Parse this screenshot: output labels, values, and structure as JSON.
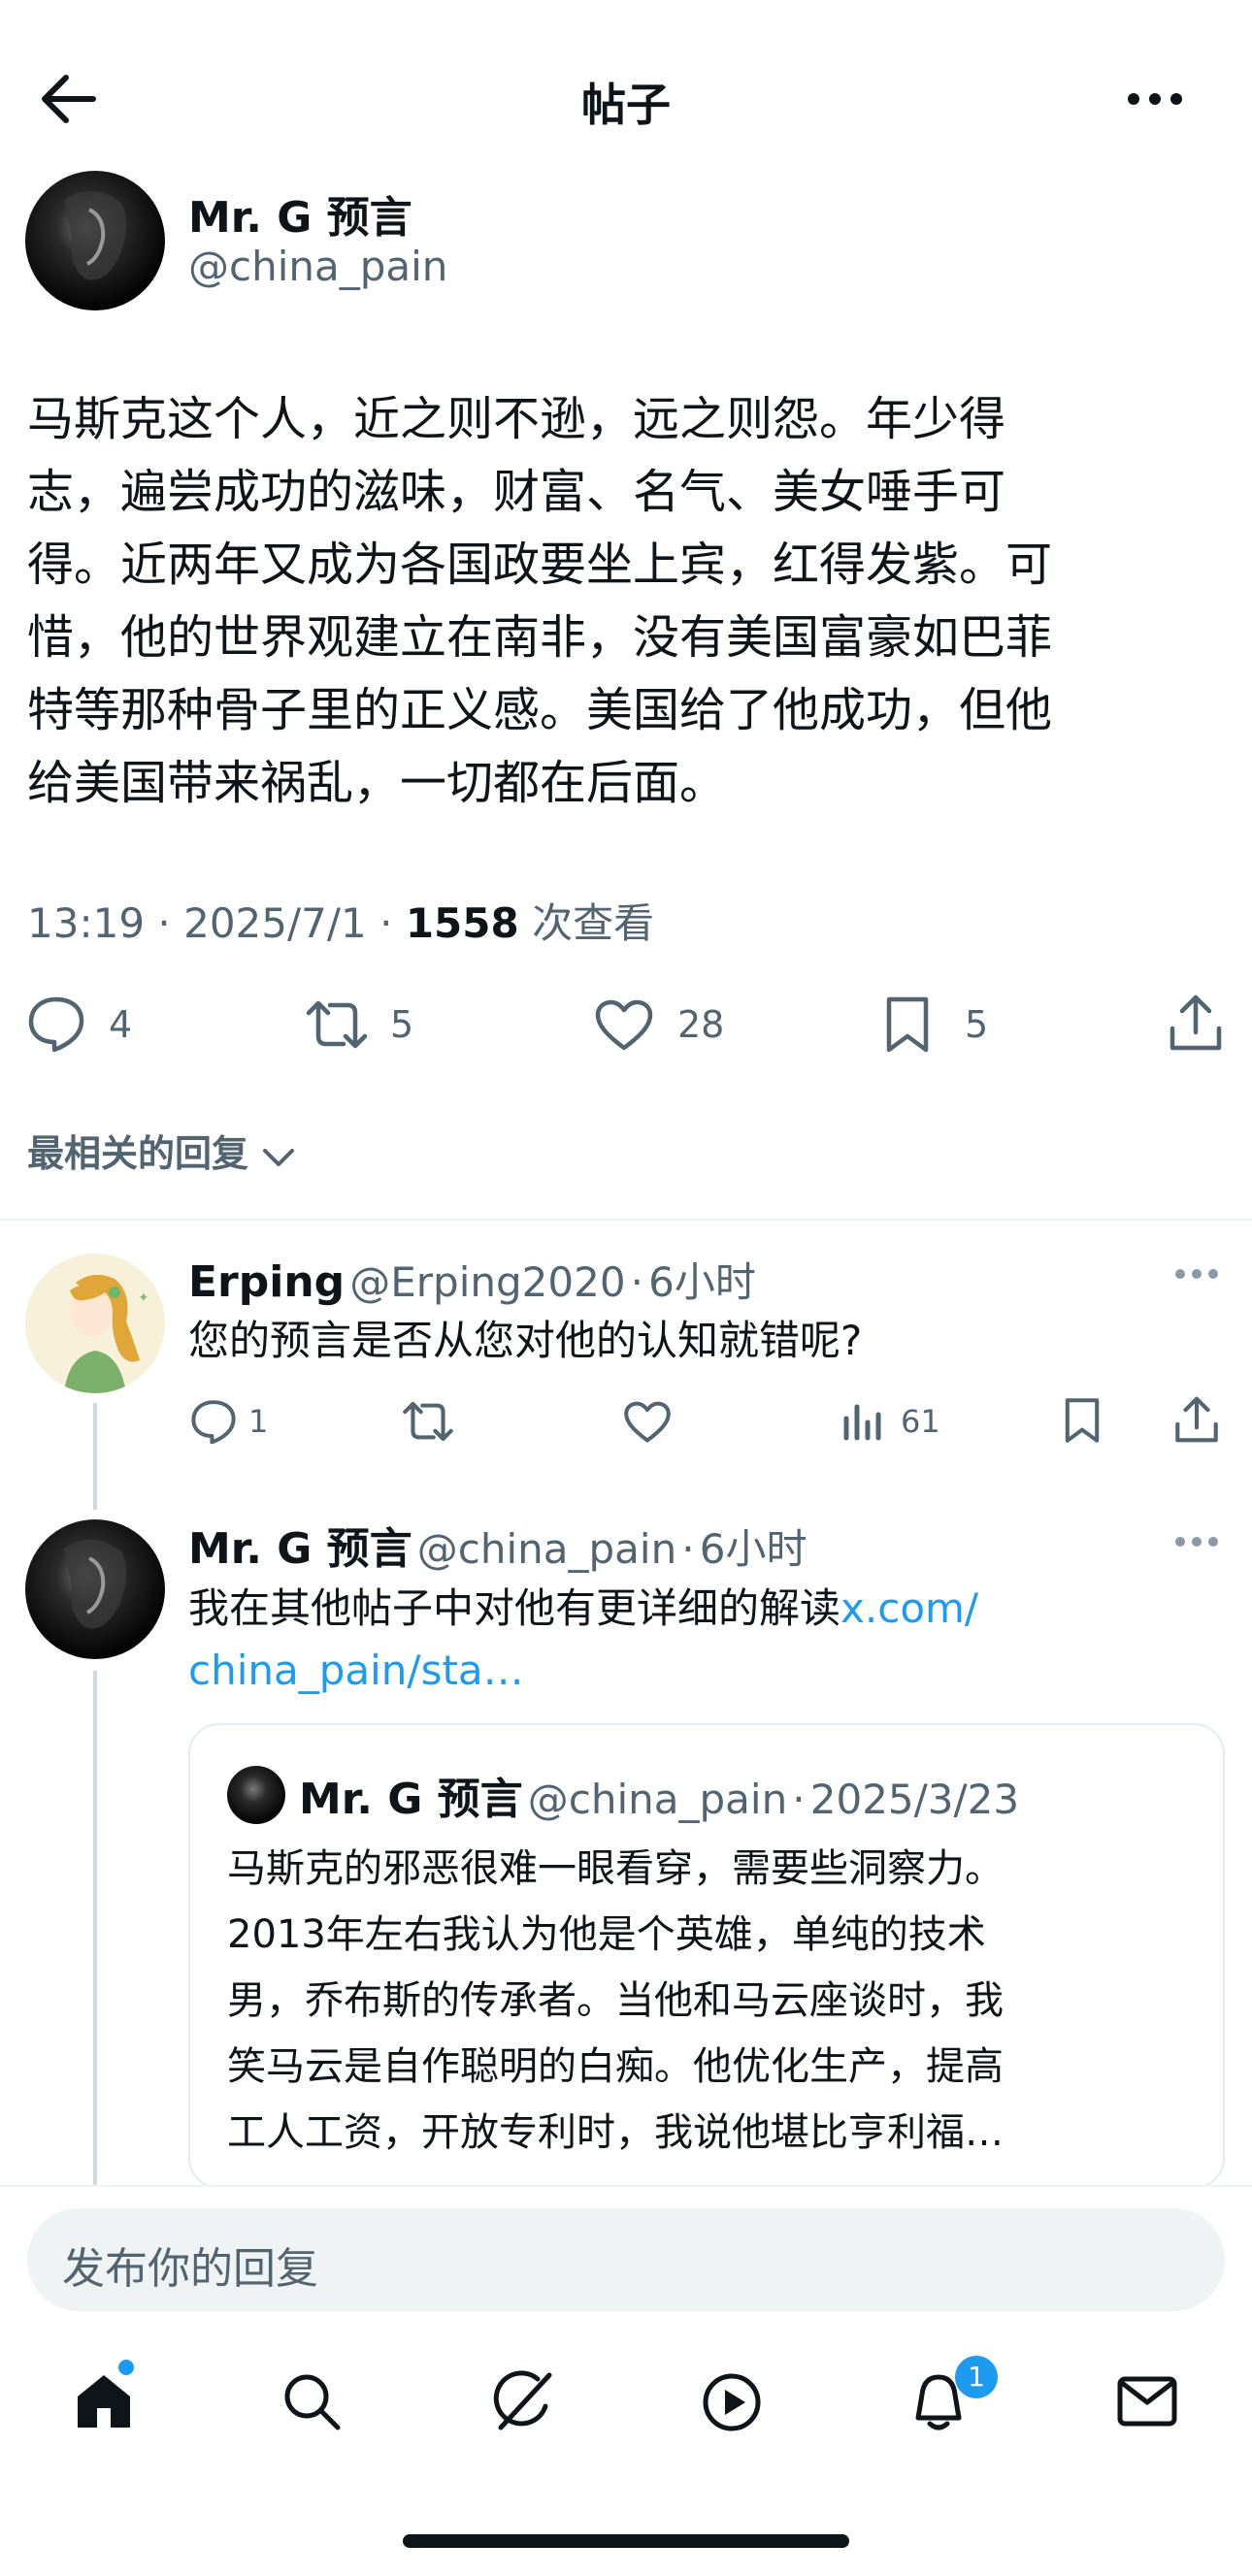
{
  "header": {
    "title": "帖子"
  },
  "post": {
    "author_name": "Mr. G 预言",
    "author_handle": "@china_pain",
    "body_lines": [
      "马斯克这个人，近之则不逊，远之则怨。年少得",
      "志，遍尝成功的滋味，财富、名气、美女唾手可",
      "得。近两年又成为各国政要坐上宾，红得发紫。可",
      "惜，他的世界观建立在南非，没有美国富豪如巴菲",
      "特等那种骨子里的正义感。美国给了他成功，但他",
      "给美国带来祸乱，一切都在后面。"
    ],
    "time": "13:19",
    "date": "2025/7/1",
    "views": "1558",
    "views_label": "次查看",
    "replies": "4",
    "reposts": "5",
    "likes": "28",
    "bookmarks": "5"
  },
  "sort_label": "最相关的回复",
  "replies": [
    {
      "name": "Erping",
      "handle": "@Erping2020",
      "age": "6小时",
      "text": "您的预言是否从您对他的认知就错呢?",
      "reply_count": "1",
      "views": "61"
    },
    {
      "name": "Mr. G 预言",
      "handle": "@china_pain",
      "age": "6小时",
      "text": "我在其他帖子中对他有更详细的解读",
      "link_part1": "x.com/",
      "link_part2": "china_pain/sta…"
    }
  ],
  "quote": {
    "name": "Mr. G 预言",
    "handle": "@china_pain",
    "date": "2025/3/23",
    "lines": [
      "马斯克的邪恶很难一眼看穿，需要些洞察力。",
      "2013年左右我认为他是个英雄，单纯的技术",
      "男，乔布斯的传承者。当他和马云座谈时，我",
      "笑马云是自作聪明的白痴。他优化生产，提高",
      "工人工资，开放专利时，我说他堪比亨利福…"
    ]
  },
  "reply_input": {
    "placeholder": "发布你的回复"
  },
  "tabbar": {
    "notifications_badge": "1"
  },
  "colors": {
    "accent": "#1d9bf0",
    "text": "#0f1419",
    "secondary": "#536471"
  }
}
